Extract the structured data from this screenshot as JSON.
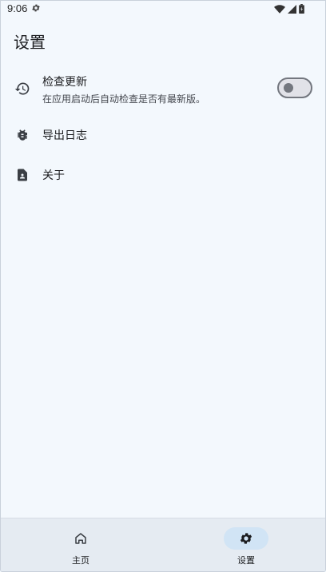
{
  "status_bar": {
    "time": "9:06"
  },
  "page": {
    "title": "设置"
  },
  "settings": {
    "check_update": {
      "label": "检查更新",
      "description": "在应用启动后自动检查是否有最新版。",
      "enabled": false
    },
    "export_log": {
      "label": "导出日志"
    },
    "about": {
      "label": "关于"
    }
  },
  "nav": {
    "home": {
      "label": "主页"
    },
    "settings": {
      "label": "设置",
      "active": true
    }
  },
  "icons": {
    "update": "history-icon",
    "log": "bug-icon",
    "about": "contact-page-icon",
    "home": "home-icon",
    "settings": "gear-icon"
  }
}
